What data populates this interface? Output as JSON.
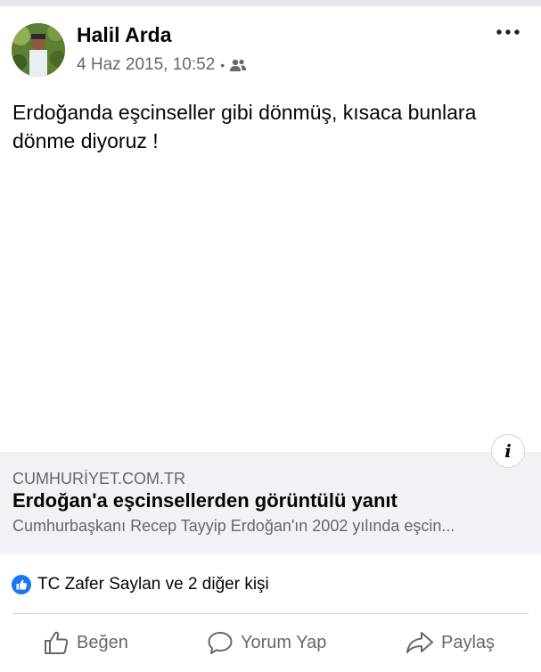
{
  "post": {
    "author": "Halil Arda",
    "date": "4 Haz 2015, 10:52",
    "separator": "•",
    "audience_icon": "friends-icon",
    "more_icon": "more-icon",
    "text": "Erdoğanda eşcinseller gibi dönmüş, kısaca bunlara dönme diyoruz !"
  },
  "link": {
    "domain": "CUMHURİYET.COM.TR",
    "title": "Erdoğan'a eşcinsellerden görüntülü yanıt",
    "description": "Cumhurbaşkanı Recep Tayyip Erdoğan'ın 2002 yılında eşcin...",
    "info_label": "i"
  },
  "reactions": {
    "text": "TC Zafer Saylan ve 2 diğer kişi",
    "icon": "like-icon"
  },
  "actions": [
    {
      "label": "Beğen",
      "icon": "thumbs-up-icon"
    },
    {
      "label": "Yorum Yap",
      "icon": "comment-icon"
    },
    {
      "label": "Paylaş",
      "icon": "share-icon"
    }
  ],
  "colors": {
    "accent": "#1877f2",
    "secondary_text": "#65676b",
    "preview_background": "#f0f2f5"
  }
}
